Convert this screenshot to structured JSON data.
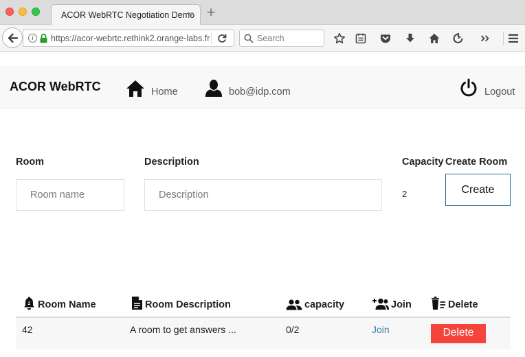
{
  "browser": {
    "tab_title": "ACOR WebRTC Negotiation Demo",
    "tab_close_glyph": "✕",
    "new_tab_glyph": "+",
    "url": "https://acor-webrtc.rethink2.orange-labs.fr",
    "search_placeholder": "Search",
    "toolbar_icons": [
      "bookmark-star-icon",
      "reading-list-icon",
      "pocket-icon",
      "download-icon",
      "home-icon",
      "history-icon",
      "overflow-chevrons-icon",
      "hamburger-menu-icon"
    ]
  },
  "navbar": {
    "brand": "ACOR WebRTC",
    "home_label": "Home",
    "user_label": "bob@idp.com",
    "logout_label": "Logout"
  },
  "form": {
    "room_label": "Room",
    "room_placeholder": "Room name",
    "description_label": "Description",
    "description_placeholder": "Description",
    "capacity_label": "Capacity",
    "capacity_value": "2",
    "create_label": "Create Room",
    "create_button": "Create"
  },
  "table": {
    "headers": {
      "name": "Room Name",
      "description": "Room Description",
      "capacity": "capacity",
      "join": "Join",
      "delete": "Delete"
    },
    "rows": [
      {
        "name": "42",
        "description": "A room to get answers ...",
        "capacity": "0/2",
        "join": "Join",
        "delete": "Delete"
      }
    ]
  },
  "colors": {
    "accent_link": "#3a80b5",
    "delete_red": "#f5443c",
    "create_border": "#2a6a8c"
  }
}
